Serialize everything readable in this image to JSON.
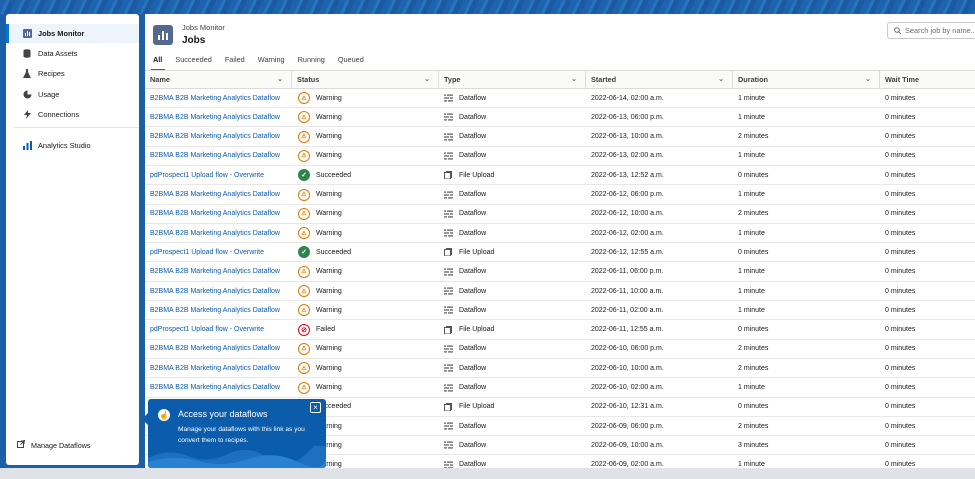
{
  "sidebar": {
    "items": [
      {
        "label": "Jobs Monitor",
        "icon": "bar-chart-icon",
        "active": true
      },
      {
        "label": "Data Assets",
        "icon": "database-icon",
        "active": false
      },
      {
        "label": "Recipes",
        "icon": "flask-icon",
        "active": false
      },
      {
        "label": "Usage",
        "icon": "pie-chart-icon",
        "active": false
      },
      {
        "label": "Connections",
        "icon": "plug-icon",
        "active": false
      }
    ],
    "analytics_studio": "Analytics Studio",
    "manage_dataflows": "Manage Dataflows"
  },
  "header": {
    "subtitle": "Jobs Monitor",
    "title": "Jobs",
    "search_placeholder": "Search job by name..."
  },
  "tabs": [
    "All",
    "Succeeded",
    "Failed",
    "Warning",
    "Running",
    "Queued"
  ],
  "columns": [
    "Name",
    "Status",
    "Type",
    "Started",
    "Duration",
    "Wait Time"
  ],
  "rows": [
    {
      "name": "B2BMA B2B Marketing Analytics Dataflow",
      "status": "Warning",
      "type": "Dataflow",
      "started": "2022-06-14, 02:00 a.m.",
      "duration": "1 minute",
      "wait": "0 minutes"
    },
    {
      "name": "B2BMA B2B Marketing Analytics Dataflow",
      "status": "Warning",
      "type": "Dataflow",
      "started": "2022-06-13, 06:00 p.m.",
      "duration": "1 minute",
      "wait": "0 minutes"
    },
    {
      "name": "B2BMA B2B Marketing Analytics Dataflow",
      "status": "Warning",
      "type": "Dataflow",
      "started": "2022-06-13, 10:00 a.m.",
      "duration": "2 minutes",
      "wait": "0 minutes"
    },
    {
      "name": "B2BMA B2B Marketing Analytics Dataflow",
      "status": "Warning",
      "type": "Dataflow",
      "started": "2022-06-13, 02:00 a.m.",
      "duration": "1 minute",
      "wait": "0 minutes"
    },
    {
      "name": "pdProspect1 Upload flow - Overwrite",
      "status": "Succeeded",
      "type": "File Upload",
      "started": "2022-06-13, 12:52 a.m.",
      "duration": "0 minutes",
      "wait": "0 minutes"
    },
    {
      "name": "B2BMA B2B Marketing Analytics Dataflow",
      "status": "Warning",
      "type": "Dataflow",
      "started": "2022-06-12, 06:00 p.m.",
      "duration": "1 minute",
      "wait": "0 minutes"
    },
    {
      "name": "B2BMA B2B Marketing Analytics Dataflow",
      "status": "Warning",
      "type": "Dataflow",
      "started": "2022-06-12, 10:00 a.m.",
      "duration": "2 minutes",
      "wait": "0 minutes"
    },
    {
      "name": "B2BMA B2B Marketing Analytics Dataflow",
      "status": "Warning",
      "type": "Dataflow",
      "started": "2022-06-12, 02:00 a.m.",
      "duration": "1 minute",
      "wait": "0 minutes"
    },
    {
      "name": "pdProspect1 Upload flow - Overwrite",
      "status": "Succeeded",
      "type": "File Upload",
      "started": "2022-06-12, 12:55 a.m.",
      "duration": "0 minutes",
      "wait": "0 minutes"
    },
    {
      "name": "B2BMA B2B Marketing Analytics Dataflow",
      "status": "Warning",
      "type": "Dataflow",
      "started": "2022-06-11, 06:00 p.m.",
      "duration": "1 minute",
      "wait": "0 minutes"
    },
    {
      "name": "B2BMA B2B Marketing Analytics Dataflow",
      "status": "Warning",
      "type": "Dataflow",
      "started": "2022-06-11, 10:00 a.m.",
      "duration": "1 minute",
      "wait": "0 minutes"
    },
    {
      "name": "B2BMA B2B Marketing Analytics Dataflow",
      "status": "Warning",
      "type": "Dataflow",
      "started": "2022-06-11, 02:00 a.m.",
      "duration": "1 minute",
      "wait": "0 minutes"
    },
    {
      "name": "pdProspect1 Upload flow - Overwrite",
      "status": "Failed",
      "type": "File Upload",
      "started": "2022-06-11, 12:55 a.m.",
      "duration": "0 minutes",
      "wait": "0 minutes"
    },
    {
      "name": "B2BMA B2B Marketing Analytics Dataflow",
      "status": "Warning",
      "type": "Dataflow",
      "started": "2022-06-10, 06:00 p.m.",
      "duration": "2 minutes",
      "wait": "0 minutes"
    },
    {
      "name": "B2BMA B2B Marketing Analytics Dataflow",
      "status": "Warning",
      "type": "Dataflow",
      "started": "2022-06-10, 10:00 a.m.",
      "duration": "2 minutes",
      "wait": "0 minutes"
    },
    {
      "name": "B2BMA B2B Marketing Analytics Dataflow",
      "status": "Warning",
      "type": "Dataflow",
      "started": "2022-06-10, 02:00 a.m.",
      "duration": "1 minute",
      "wait": "0 minutes"
    },
    {
      "name": "",
      "status": "Succeeded",
      "type": "File Upload",
      "started": "2022-06-10, 12:31 a.m.",
      "duration": "0 minutes",
      "wait": "0 minutes"
    },
    {
      "name": "",
      "status": "Warning",
      "type": "Dataflow",
      "started": "2022-06-09, 06:00 p.m.",
      "duration": "2 minutes",
      "wait": "0 minutes"
    },
    {
      "name": "",
      "status": "Warning",
      "type": "Dataflow",
      "started": "2022-06-09, 10:00 a.m.",
      "duration": "3 minutes",
      "wait": "0 minutes"
    },
    {
      "name": "",
      "status": "Warning",
      "type": "Dataflow",
      "started": "2022-06-09, 02:00 a.m.",
      "duration": "1 minute",
      "wait": "0 minutes"
    }
  ],
  "popover": {
    "title": "Access your dataflows",
    "body": "Manage your dataflows with this link as you convert them to recipes."
  },
  "colors": {
    "link": "#0b5cab",
    "warning": "#dd7a01",
    "success": "#2e844a",
    "error": "#ea001e"
  }
}
